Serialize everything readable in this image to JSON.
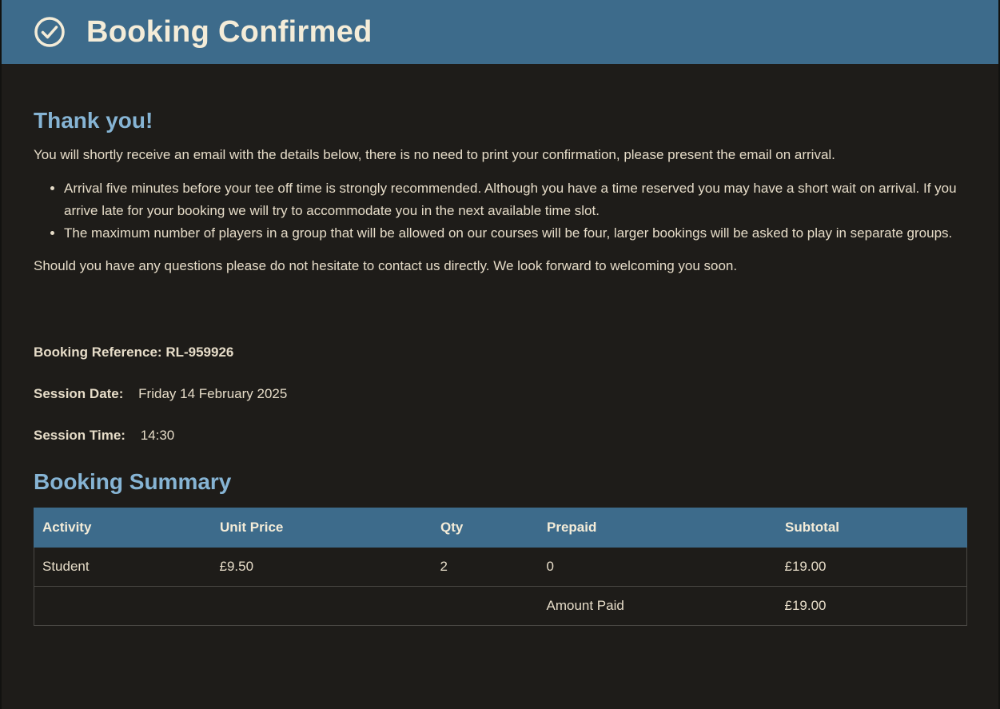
{
  "header": {
    "title": "Booking Confirmed",
    "icon": "check-circle-icon"
  },
  "thanks": {
    "heading": "Thank you!",
    "intro": "You will shortly receive an email with the details below, there is no need to print your confirmation, please present the email on arrival.",
    "notes": [
      "Arrival five minutes before your tee off time is strongly recommended. Although you have a time reserved you may have a short wait on arrival. If you arrive late for your booking we will try to accommodate you in the next available time slot.",
      "The maximum number of players in a group that will be allowed on our courses will be four, larger bookings will be asked to play in separate groups."
    ],
    "outro": "Should you have any questions please do not hesitate to contact us directly. We look forward to welcoming you soon."
  },
  "details": {
    "reference_label": "Booking Reference:",
    "reference_value": "RL-959926",
    "date_label": "Session Date:",
    "date_value": "Friday 14 February 2025",
    "time_label": "Session Time:",
    "time_value": "14:30"
  },
  "summary": {
    "heading": "Booking Summary",
    "columns": [
      "Activity",
      "Unit Price",
      "Qty",
      "Prepaid",
      "Subtotal"
    ],
    "rows": [
      [
        "Student",
        "£9.50",
        "2",
        "0",
        "£19.00"
      ]
    ],
    "amount_paid_label": "Amount Paid",
    "amount_paid_value": "£19.00"
  },
  "colors": {
    "header_bg": "#3d6b8b",
    "page_bg": "#1e1c19",
    "heading": "#86b4d4",
    "text": "#e6dcc8"
  }
}
